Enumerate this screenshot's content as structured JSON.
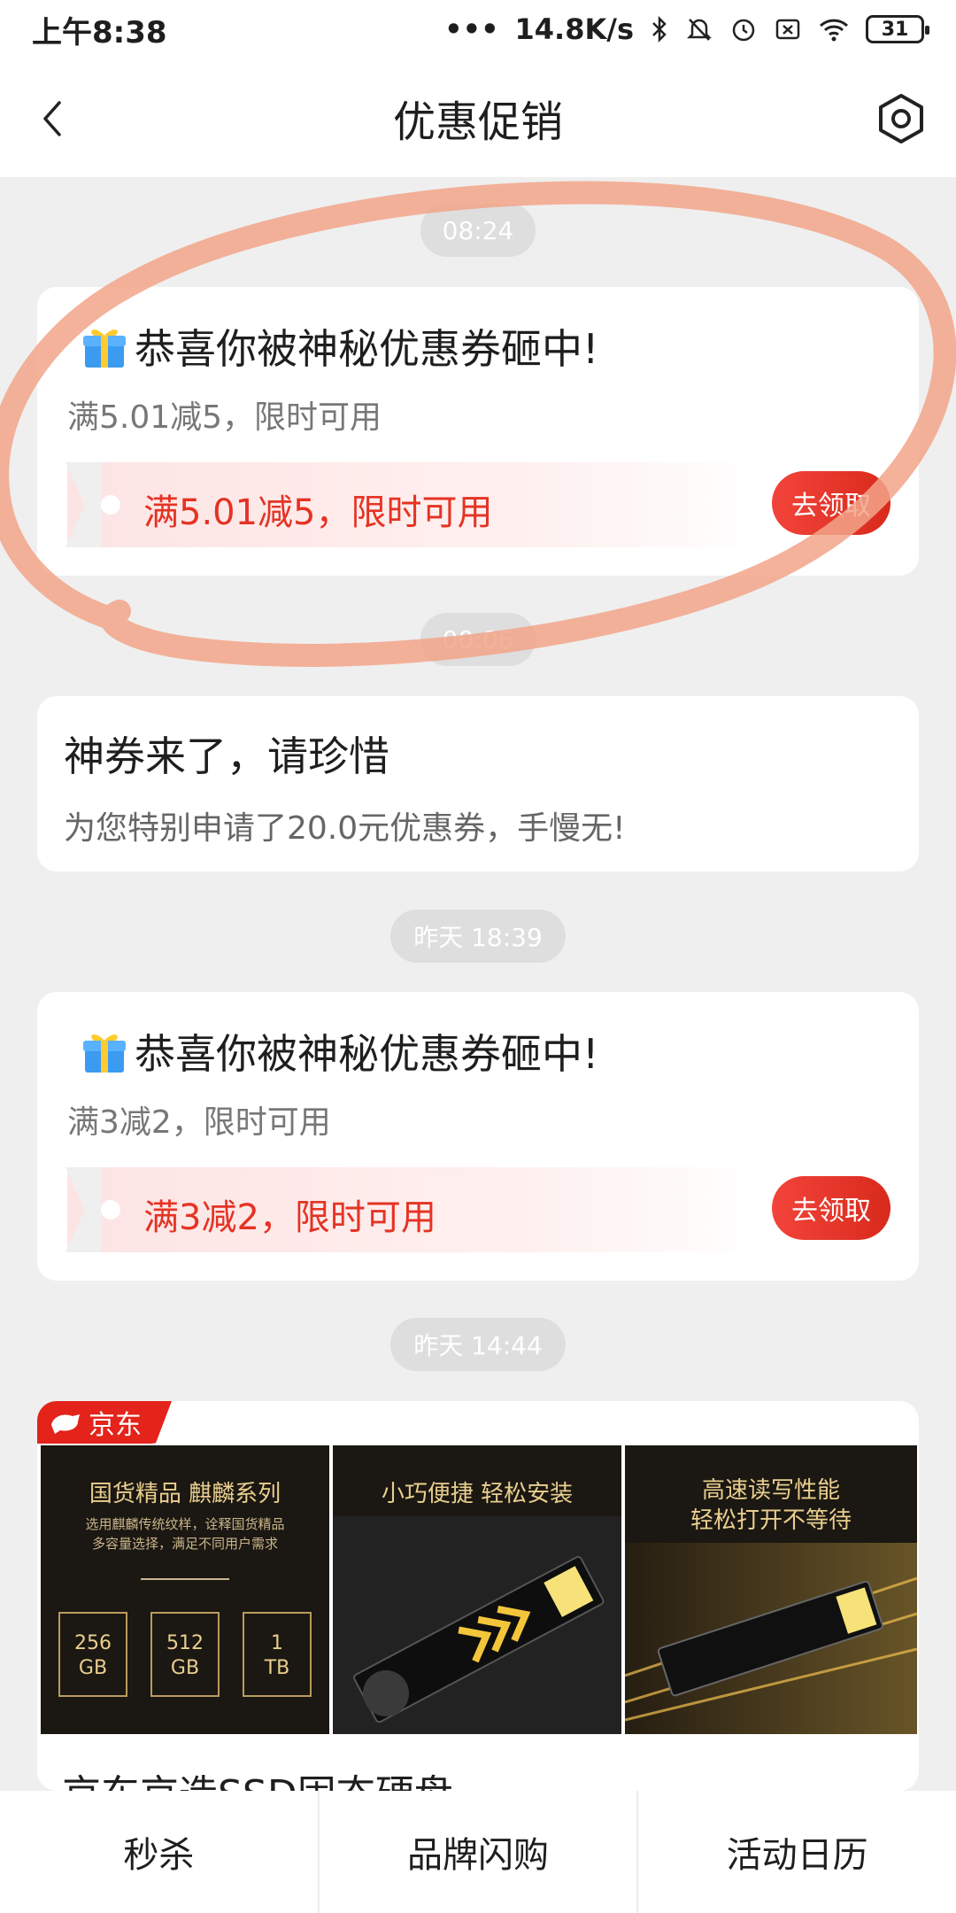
{
  "status_bar": {
    "time": "上午8:38",
    "network_speed": "14.8K/s",
    "battery": "31",
    "icons": [
      "bluetooth-icon",
      "mute-icon",
      "alarm-icon",
      "sim-off-icon",
      "wifi-icon",
      "battery-icon"
    ]
  },
  "header": {
    "title": "优惠促销",
    "back_icon": "back-chevron-icon",
    "settings_icon": "settings-icon"
  },
  "messages": [
    {
      "time": "08:24",
      "title": "恭喜你被神秘优惠券砸中!",
      "subtitle": "满5.01减5，限时可用",
      "coupon_text": "满5.01减5，限时可用",
      "button": "去领取"
    },
    {
      "time": "00:06",
      "title": "神券来了，请珍惜",
      "subtitle": "为您特别申请了20.0元优惠券，手慢无!"
    },
    {
      "time": "昨天 18:39",
      "title": "恭喜你被神秘优惠券砸中!",
      "subtitle": "满3减2，限时可用",
      "coupon_text": "满3减2，限时可用",
      "button": "去领取"
    },
    {
      "time": "昨天 14:44",
      "badge": "京东",
      "title": "京东京造SSD固态硬盘",
      "panels": {
        "p1_title": "国货精品 麒麟系列",
        "p1_small_1": "选用麒麟传统纹样，诠释国货精品",
        "p1_small_2": "多容量选择，满足不同用户需求",
        "caps": [
          {
            "size": "256",
            "unit": "GB"
          },
          {
            "size": "512",
            "unit": "GB"
          },
          {
            "size": "1",
            "unit": "TB"
          }
        ],
        "p2_title": "小巧便捷 轻松安装",
        "p3_title_1": "高速读写性能",
        "p3_title_2": "轻松打开不等待"
      }
    }
  ],
  "bottom_tabs": [
    "秒杀",
    "品牌闪购",
    "活动日历"
  ],
  "colors": {
    "accent_red": "#e53324",
    "button_red": "#e5392a",
    "annotation": "#f2a58a"
  }
}
